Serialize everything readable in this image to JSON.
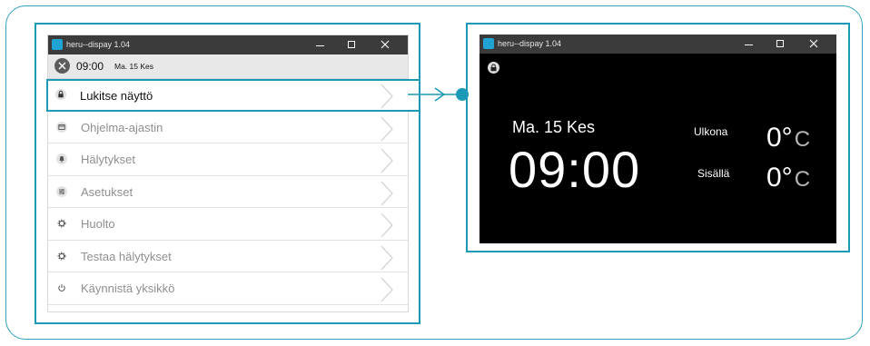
{
  "left_window": {
    "title": "heru--dispay 1.04",
    "status": {
      "time": "09:00",
      "date": "Ma. 15 Kes"
    },
    "menu": [
      {
        "label": "Lukitse näyttö",
        "icon": "lock-icon",
        "active": true
      },
      {
        "label": "Ohjelma-ajastin",
        "icon": "calendar-icon",
        "active": false
      },
      {
        "label": "Hälytykset",
        "icon": "bell-icon",
        "active": false
      },
      {
        "label": "Asetukset",
        "icon": "sliders-icon",
        "active": false
      },
      {
        "label": "Huolto",
        "icon": "gear-icon",
        "active": false
      },
      {
        "label": "Testaa hälytykset",
        "icon": "gear-icon",
        "active": false
      },
      {
        "label": "Käynnistä yksikkö",
        "icon": "power-icon",
        "active": false
      }
    ]
  },
  "right_window": {
    "title": "heru--dispay 1.04",
    "date": "Ma. 15 Kes",
    "time": "09:00",
    "outdoor": {
      "label": "Ulkona",
      "value": "0°",
      "unit": "C"
    },
    "indoor": {
      "label": "Sisällä",
      "value": "0°",
      "unit": "C"
    }
  },
  "colors": {
    "accent": "#1b9ab8",
    "titlebar": "#3b3b3b",
    "app_icon": "#1ea3d3",
    "screen_bg": "#000000"
  }
}
